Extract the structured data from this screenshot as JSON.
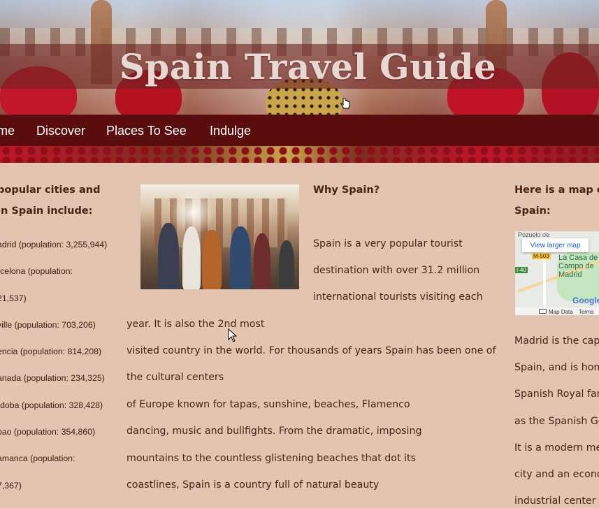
{
  "header": {
    "title": "Spain Travel Guide"
  },
  "nav": {
    "items": [
      {
        "label": "Home",
        "visible_label": "me"
      },
      {
        "label": "Discover"
      },
      {
        "label": "Places To See"
      },
      {
        "label": "Indulge"
      }
    ]
  },
  "left": {
    "heading_line1": "popular cities and",
    "heading_line2": "in Spain include:",
    "cities": [
      "adrid (population: 3,255,944)",
      "rcelona (population:",
      "21,537)",
      "ville (population: 703,206)",
      "encia (population: 814,208)",
      "anada (population: 234,325)",
      "rdoba (population: 328,428)",
      "bao (population: 354,860)",
      "amanca (population:",
      "7,367)"
    ]
  },
  "center": {
    "photo_alt": "tourists-photo",
    "heading": "Why Spain?",
    "lines": [
      "Spain is a very popular tourist",
      "destination with over 31.2 million",
      "international tourists visiting each",
      "year. It is also the 2nd most",
      "visited country in the world. For thousands of years Spain has been one of",
      "the cultural centers",
      "of Europe known for tapas, sunshine, beaches, Flamenco",
      "dancing, music and bullfights. From the dramatic, imposing",
      "mountains to the countless glistening beaches that dot its",
      "coastlines, Spain is a country full of natural beauty"
    ]
  },
  "right": {
    "heading_line1": "Here is a map of",
    "heading_line2": "Spain:",
    "map": {
      "link_label": "View larger map",
      "top_text": "Pozuelo de",
      "place_name": "La Casa de Campo de Madrid",
      "road_badge": "M-503",
      "road_badge2": "I-40",
      "brand": "Google",
      "footer_data": "Map Data",
      "footer_terms": "Terms"
    },
    "lines": [
      "Madrid is the capi",
      "Spain, and is hom",
      "Spanish Royal fam",
      "as the Spanish Go",
      "It is a modern me",
      "city and an econo",
      "industrial center"
    ]
  }
}
